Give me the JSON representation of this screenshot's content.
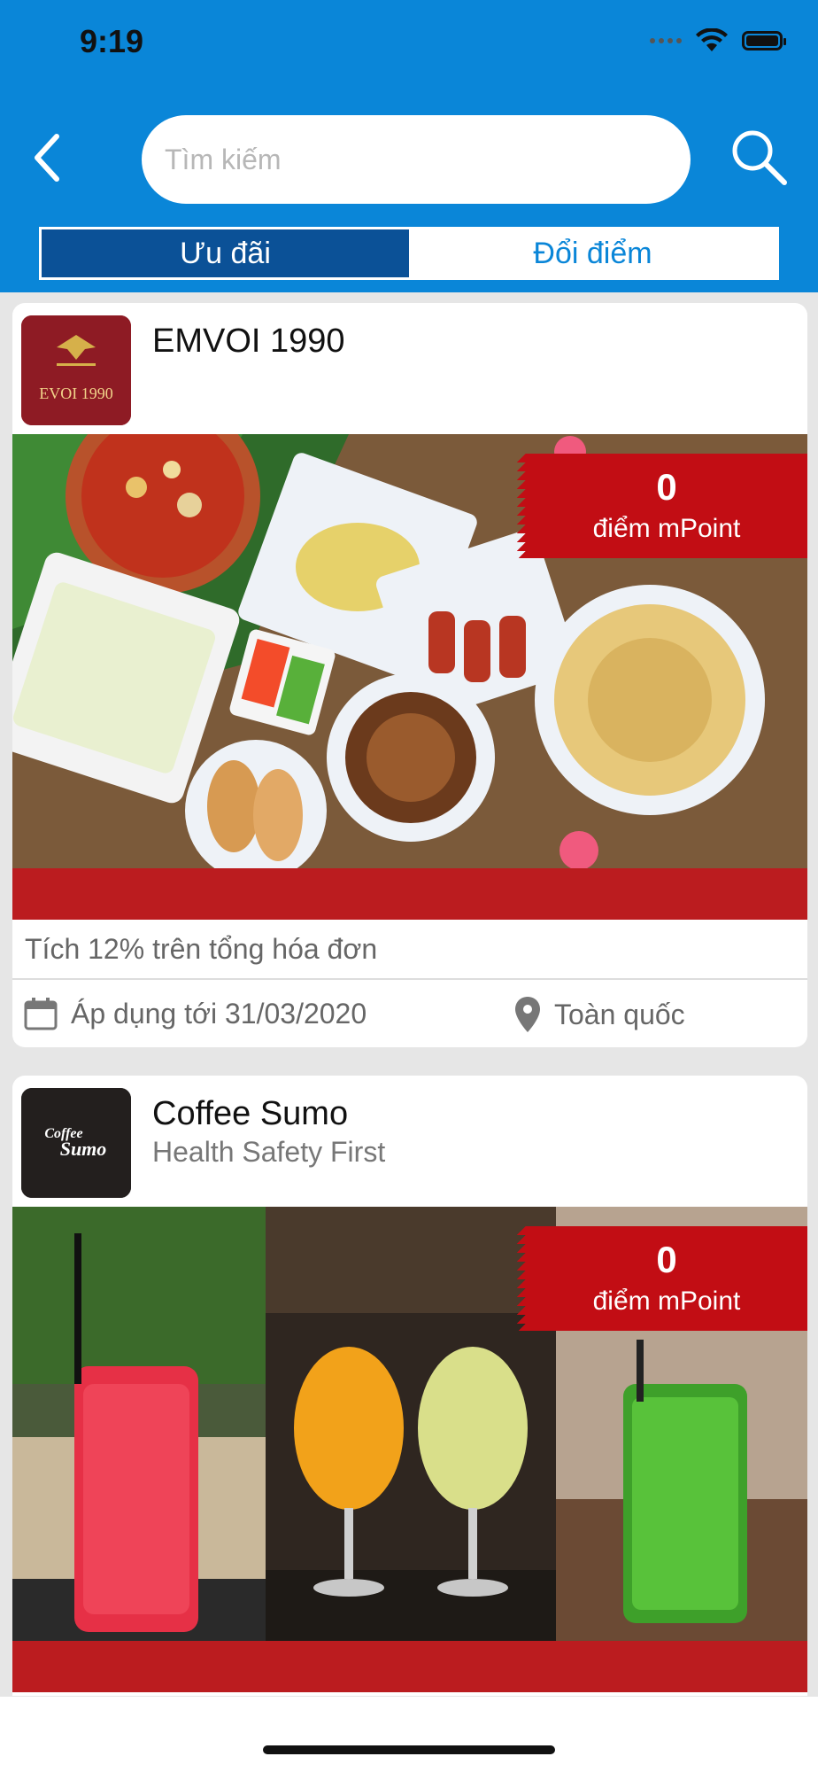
{
  "status_bar": {
    "time": "9:19"
  },
  "search": {
    "placeholder": "Tìm kiếm"
  },
  "tabs": [
    {
      "label": "Ưu đãi",
      "active": true
    },
    {
      "label": "Đổi điểm",
      "active": false
    }
  ],
  "offers": [
    {
      "brand": "EMVOI 1990",
      "subtitle": "",
      "logo_text": "EVOI 1990",
      "points_value": "0",
      "points_label": "điểm mPoint",
      "deal": "Tích 12% trên tổng hóa đơn",
      "valid_until": "Áp dụng tới 31/03/2020",
      "location": "Toàn quốc"
    },
    {
      "brand": "Coffee Sumo",
      "subtitle": "Health Safety First",
      "logo_text_top": "Coffee",
      "logo_text_bottom": "Sumo",
      "points_value": "0",
      "points_label": "điểm mPoint"
    }
  ],
  "colors": {
    "header_blue": "#0a86d8",
    "active_tab": "#0b5197",
    "badge_red": "#c20d14",
    "strip_red": "#bb1c1f"
  },
  "icons": [
    "back-chevron-icon",
    "search-icon",
    "calendar-icon",
    "location-pin-icon"
  ]
}
